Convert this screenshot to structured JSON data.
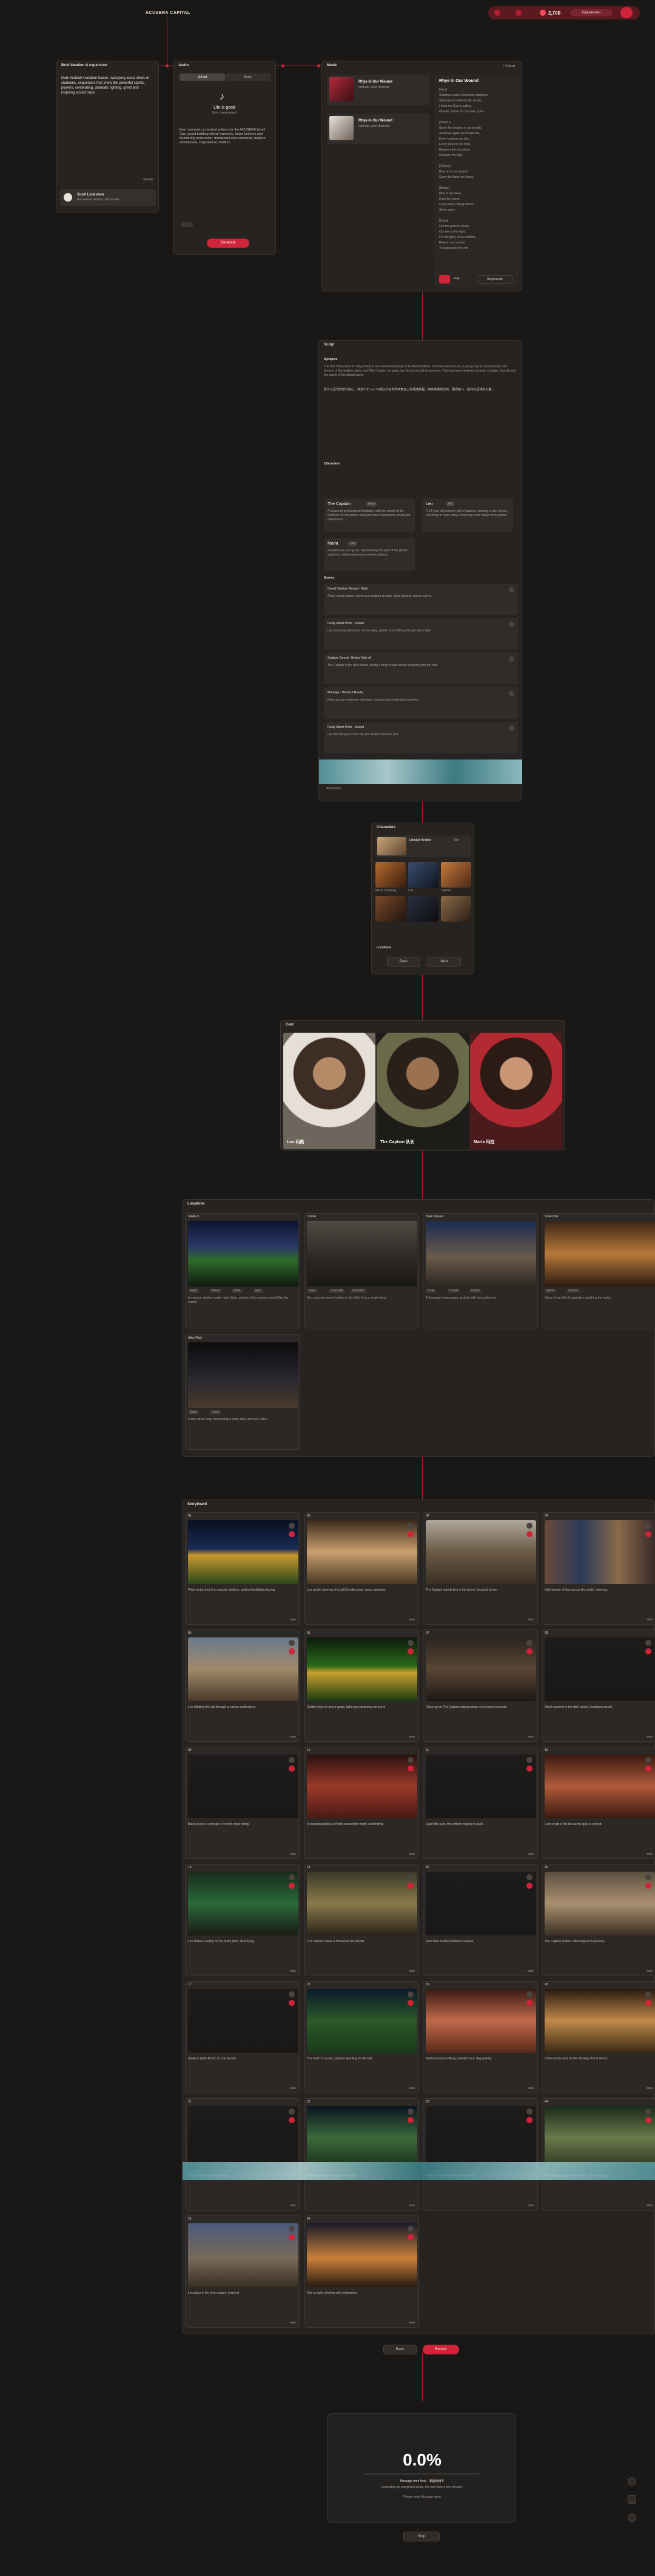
{
  "app": {
    "title": "ACUSERA CAPITAL",
    "credits": "2,700",
    "plan_button": "Upgrade plan",
    "status_colors": {
      "accent": "#d0243a",
      "bg": "#1a1816",
      "panel": "#262321"
    }
  },
  "step1": {
    "header": "Brief ideation & expansion",
    "intro": "Dark football invitation teaser, sweeping aerial shots of stadiums, sequences that show the powerful sports, players, celebrating, dramatic lighting, great and inspiring sound track.",
    "sample_label": "Sample",
    "agent_name": "Scott Lickloken",
    "agent_sub": "Ad creative director, storyboard"
  },
  "step2": {
    "header": "Audio",
    "tab_a": "Upload",
    "tab_b": "Music",
    "track_title": "Life is good",
    "track_sub": "Epic, inspirational",
    "desc": "Epic cinematic orchestral anthem for the ACUSERA World Cup, grand building choral harmonic, brass fanfares and thundering percussion, triumphant and emotional, stadium atmosphere, inspirational, stadium.",
    "button": "Generate"
  },
  "step3": {
    "header": "Music",
    "header_right": "+ Upload",
    "tracks": [
      {
        "title": "Rhye in Our Wound",
        "sub": "Intimate, soul, dramatic"
      },
      {
        "title": "Rhye in Our Wound",
        "sub": "Intimate, soul, dramatic"
      }
    ],
    "lyrics_title": "Rhye In Our Wound",
    "lyrics": [
      "[Intro]",
      "Shadows under December stadiums,",
      "Shadows in white Nordic bones,",
      "I think my God is calling,",
      "Wonder before it's not even gone.",
      "",
      "[Verse 1]",
      "Some fire dreams in our breath,",
      "Shadows again we whispered,",
      "Every beat on our sky...",
      "Every step on our road,",
      "Between the last stand,",
      "Rising to the light,",
      "",
      "[Chorus]",
      "Rise up in our wound,",
      "Carry the flame we found,",
      "",
      "[Bridge]",
      "Rise in the deep,",
      "Each fire burns,",
      "Carry every calling before,",
      "All we carry,",
      "",
      "[Outro]",
      "Our fire goes to chase,",
      "Our ride to the light,",
      "For the glory of our nations,",
      "Rhye in our wound,",
      "To stand until the end"
    ],
    "btn_left": "Play",
    "btn_right": "Regenerate"
  },
  "step4": {
    "header": "Script",
    "synopsis_label": "Synopsis",
    "synopsis": "The film \"Rhye Wound\" fully rooted in the emotional journey of football ambition. It centers around Leo, a young boy in a worn jersey who dreams of the stadium lights, and The Captain, an aging star facing his last tournament. Their journeys intertwine through struggle, triumph and the power of the global game.",
    "synopsis_cn": "影片以足球梦想为核心，讲述少年 Leo 与老队长在世界杯舞台上的情感旅程。两条故事线交织，展现奋斗、胜利与足球的力量。",
    "characters_label": "Characters",
    "characters": [
      {
        "name": "The Captain",
        "tag": "Hero",
        "desc": "A seasoned professional footballer, with the weight of the world on his shoulders, facing his final tournament, proud and determined."
      },
      {
        "name": "Leo",
        "tag": "Kid",
        "desc": "A 10-year-old dreamer, full of passion, wearing a worn jersey, practicing in dusty alleys, believing in the magic of the game."
      },
      {
        "name": "Marla",
        "tag": "Fan",
        "desc": "A passionate young fan, representing the spirit of the global audience, celebrating every moment with joy."
      }
    ],
    "scenes_label": "Scenes",
    "scenes": [
      {
        "title": "Grand Stadium Reveal - Night",
        "desc": "Aerial sweep above a luminous stadium at night, lights blazing, crowd roaring."
      },
      {
        "title": "Dusty Street Pitch - Sunset",
        "desc": "Leo practicing alone in a narrow alley, golden dust drifting through warm light."
      },
      {
        "title": "Stadium Tunnel - Before Kick-off",
        "desc": "The Captain in the dark tunnel, taking a deep breath before stepping onto the field."
      },
      {
        "title": "Montage - World of Rivalry",
        "desc": "Fans across continents watching, shouting and celebrating together."
      },
      {
        "title": "Dusty Street Pitch - Sunset",
        "desc": "Leo lifts his eyes to the sky, the dream becomes real."
      }
    ],
    "footer": "Add scene"
  },
  "step5": {
    "header": "Characters",
    "items": [
      {
        "name": "Lifestyle Brother",
        "tag": "Kid"
      },
      {
        "name": "Marla Cheering",
        "tag": "Fan"
      },
      {
        "name": "Leo",
        "tag": "Kid"
      },
      {
        "name": "Captain",
        "tag": "Hero"
      }
    ],
    "section2": "Locations",
    "btn_a": "Back",
    "btn_b": "Next"
  },
  "step6": {
    "header": "Cast",
    "cast": [
      {
        "name": "Leo 利奥"
      },
      {
        "name": "The Captain 队长"
      },
      {
        "name": "Marla 玛拉"
      }
    ]
  },
  "step7": {
    "header": "Locations",
    "locations": [
      {
        "title": "Stadium",
        "tags": [
          "Night",
          "Aerial",
          "Wide",
          "Epic"
        ],
        "desc": "A massive stadium under night lights, glowing field, roaring crowd filling the stands."
      },
      {
        "title": "Tunnel",
        "tags": [
          "Dark",
          "Concrete",
          "Dramatic"
        ],
        "desc": "Dim concrete tunnel leading to the field, lit by a single lamp."
      },
      {
        "title": "Town Square",
        "tags": [
          "Dusk",
          "Crowd",
          "Urban"
        ],
        "desc": "A European town square at dusk with fans gathering."
      },
      {
        "title": "Street Bar",
        "tags": [
          "Warm",
          "Interior"
        ],
        "desc": "Warm-lit bar full of supporters watching the match."
      },
      {
        "title": "Alley Pitch",
        "tags": [
          "Night",
          "Lamp"
        ],
        "desc": "A lone street lamp illuminating a dusty alley used as a pitch."
      }
    ]
  },
  "step8": {
    "header": "Storyboard",
    "shot_prefix": "Shot",
    "shots": [
      {
        "label": "01",
        "kind": "stadium",
        "desc": "Wide aerial shot of a massive stadium, golden floodlights blazing."
      },
      {
        "label": "02",
        "kind": "kick",
        "desc": "Low angle close-up of a ball hit with power, grass spraying."
      },
      {
        "label": "03",
        "kind": "captain",
        "desc": "The Captain stands firm in the tunnel, focused, tense."
      },
      {
        "label": "04",
        "kind": "fans",
        "desc": "Split-screen of fans across the world, cheering."
      },
      {
        "label": "05",
        "kind": "boy",
        "desc": "Leo dribbles the ball through a narrow sunlit street."
      },
      {
        "label": "06",
        "kind": "boot",
        "desc": "Golden boot on green grass, light rays streaming across it."
      },
      {
        "label": "07",
        "kind": "captain2",
        "desc": "Close-up on The Captain wiping sweat, eyes locked on goal."
      },
      {
        "label": "08",
        "kind": "dark",
        "desc": "Silent moment in the dark tunnel, heartbeat sound."
      },
      {
        "label": "09",
        "kind": "dark",
        "desc": "Black screen, a whisper of crowd noise rising."
      },
      {
        "label": "10",
        "kind": "crowd",
        "desc": "A sweeping tableau of fans around the world, celebrating."
      },
      {
        "label": "11",
        "kind": "dark",
        "desc": "Quiet title card, the anthem begins to swell."
      },
      {
        "label": "12",
        "kind": "crowd2",
        "desc": "Fans erupt in the bar as the goal is scored."
      },
      {
        "label": "13",
        "kind": "kick2",
        "desc": "Leo strikes a volley on the dusty pitch, dust flying."
      },
      {
        "label": "14",
        "kind": "captain3",
        "desc": "The Captain raises a fist toward the stands."
      },
      {
        "label": "15",
        "kind": "dark",
        "desc": "Slow fade to black between scenes."
      },
      {
        "label": "16",
        "kind": "captain4",
        "desc": "The Captain smiles, reflecting on his journey."
      },
      {
        "label": "17",
        "kind": "dark",
        "desc": "Stadium lights flicker on one by one."
      },
      {
        "label": "18",
        "kind": "match",
        "desc": "The match in action, players sprinting for the ball."
      },
      {
        "label": "19",
        "kind": "fan",
        "desc": "Marla screams with joy, painted face, flag waving."
      },
      {
        "label": "20",
        "kind": "boot2",
        "desc": "Close on the boot as the winning shot is struck."
      },
      {
        "label": "21",
        "kind": "dark",
        "desc": "Silence before the final whistle."
      },
      {
        "label": "22",
        "kind": "match2",
        "desc": "Team celebrates in a pile on the pitch."
      },
      {
        "label": "23",
        "kind": "dark",
        "desc": "Fade out with the anthem's final note."
      },
      {
        "label": "24",
        "kind": "player",
        "desc": "The Captain walks off the pitch, crowd chanting."
      },
      {
        "label": "25",
        "kind": "town",
        "desc": "Leo plays in the town square, inspired."
      },
      {
        "label": "26",
        "kind": "city",
        "desc": "City at night, glowing with celebration."
      }
    ],
    "btn_a": "Back",
    "btn_b": "Render"
  },
  "step9": {
    "progress": "0.0%",
    "progress_value": 0,
    "message": "Message from Hole - 准备就绪中",
    "sub1": "Generating all storyboard shots, this may take a few minutes.",
    "sub2": "Please keep this page open",
    "button": "Stop"
  }
}
